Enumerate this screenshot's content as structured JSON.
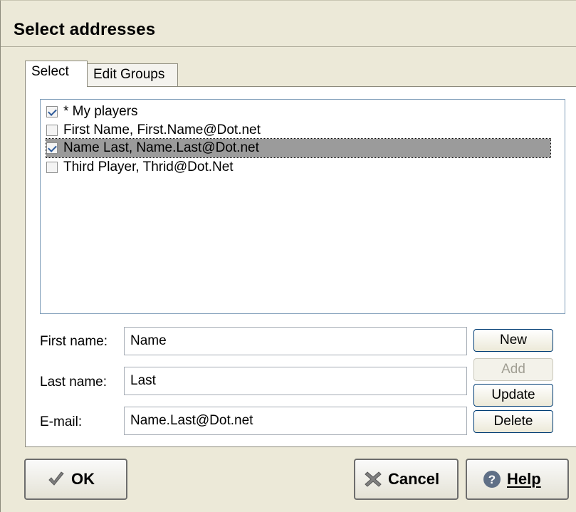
{
  "dialog": {
    "title": "Select addresses"
  },
  "tabs": [
    {
      "label": "Select",
      "active": true
    },
    {
      "label": "Edit Groups",
      "active": false
    }
  ],
  "list": {
    "items": [
      {
        "text": "* My players",
        "checked": true,
        "selected": false
      },
      {
        "text": "First Name, First.Name@Dot.net",
        "checked": false,
        "selected": false
      },
      {
        "text": "Name Last, Name.Last@Dot.net",
        "checked": true,
        "selected": true
      },
      {
        "text": "Third Player, Thrid@Dot.Net",
        "checked": false,
        "selected": false
      }
    ]
  },
  "form": {
    "first_name": {
      "label": "First name:",
      "value": "Name"
    },
    "last_name": {
      "label": "Last name:",
      "value": "Last"
    },
    "email": {
      "label": "E-mail:",
      "value": "Name.Last@Dot.net"
    }
  },
  "side_buttons": {
    "new": "New",
    "add": "Add",
    "update": "Update",
    "delete": "Delete"
  },
  "footer": {
    "ok": "OK",
    "cancel": "Cancel",
    "help": "Help"
  },
  "colors": {
    "dialog_bg": "#ece9d8",
    "selection": "#9b9b9b",
    "check": "#2e5b9a",
    "help_icon": "#5f6f86"
  }
}
